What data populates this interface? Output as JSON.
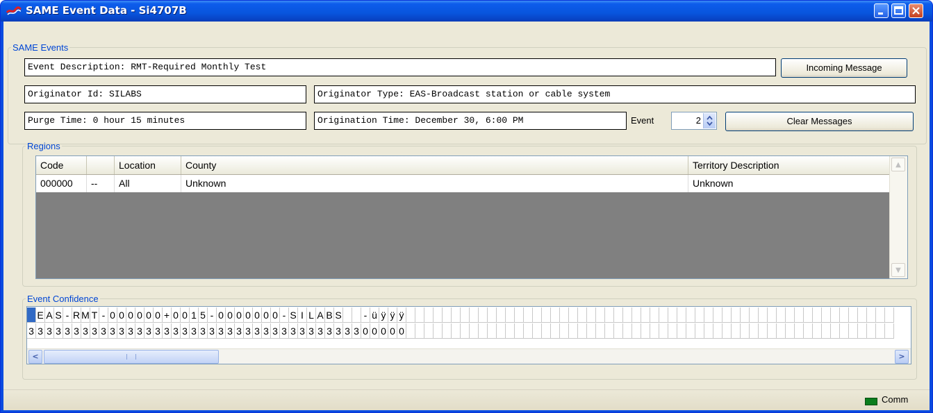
{
  "window": {
    "title": "SAME Event Data - Si4707B"
  },
  "same_events": {
    "legend": "SAME Events",
    "event_description": "Event Description: RMT-Required Monthly Test",
    "incoming_message_button": "Incoming Message",
    "originator_id": "Originator Id: SILABS",
    "originator_type": "Originator Type: EAS-Broadcast station or cable system",
    "purge_time": "Purge Time: 0 hour 15 minutes",
    "origination_time": "Origination Time: December 30, 6:00 PM",
    "event_label": "Event",
    "event_number": "2",
    "clear_messages_button": "Clear Messages"
  },
  "regions": {
    "legend": "Regions",
    "columns": [
      "Code",
      "",
      "Location",
      "County",
      "Territory Description"
    ],
    "rows": [
      [
        "000000",
        "--",
        "All",
        "Unknown",
        "Unknown"
      ]
    ]
  },
  "event_confidence": {
    "legend": "Event Confidence",
    "chars": [
      "",
      "E",
      "A",
      "S",
      "-",
      "R",
      "M",
      "T",
      "-",
      "0",
      "0",
      "0",
      "0",
      "0",
      "0",
      "+",
      "0",
      "0",
      "1",
      "5",
      "-",
      "0",
      "0",
      "0",
      "0",
      "0",
      "0",
      "0",
      "-",
      "S",
      "I",
      "L",
      "A",
      "B",
      "S",
      "",
      "",
      "-",
      "ü",
      "ÿ",
      "ÿ",
      "ÿ",
      "",
      "",
      "",
      "",
      "",
      "",
      "",
      "",
      "",
      "",
      "",
      "",
      "",
      "",
      "",
      "",
      "",
      "",
      "",
      "",
      "",
      "",
      "",
      "",
      "",
      "",
      "",
      "",
      "",
      "",
      "",
      "",
      "",
      "",
      "",
      "",
      "",
      "",
      "",
      "",
      "",
      "",
      "",
      "",
      "",
      "",
      "",
      "",
      "",
      "",
      "",
      "",
      "",
      ""
    ],
    "levels": [
      "3",
      "3",
      "3",
      "3",
      "3",
      "3",
      "3",
      "3",
      "3",
      "3",
      "3",
      "3",
      "3",
      "3",
      "3",
      "3",
      "3",
      "3",
      "3",
      "3",
      "3",
      "3",
      "3",
      "3",
      "3",
      "3",
      "3",
      "3",
      "3",
      "3",
      "3",
      "3",
      "3",
      "3",
      "3",
      "3",
      "3",
      "0",
      "0",
      "0",
      "0",
      "0",
      "",
      "",
      "",
      "",
      "",
      "",
      "",
      "",
      "",
      "",
      "",
      "",
      "",
      "",
      "",
      "",
      "",
      "",
      "",
      "",
      "",
      "",
      "",
      "",
      "",
      "",
      "",
      "",
      "",
      "",
      "",
      "",
      "",
      "",
      "",
      "",
      "",
      "",
      "",
      "",
      "",
      "",
      "",
      "",
      "",
      "",
      "",
      "",
      "",
      "",
      "",
      "",
      "",
      ""
    ]
  },
  "status_bar": {
    "comm_label": "Comm",
    "comm_color": "#0a7d1c"
  }
}
